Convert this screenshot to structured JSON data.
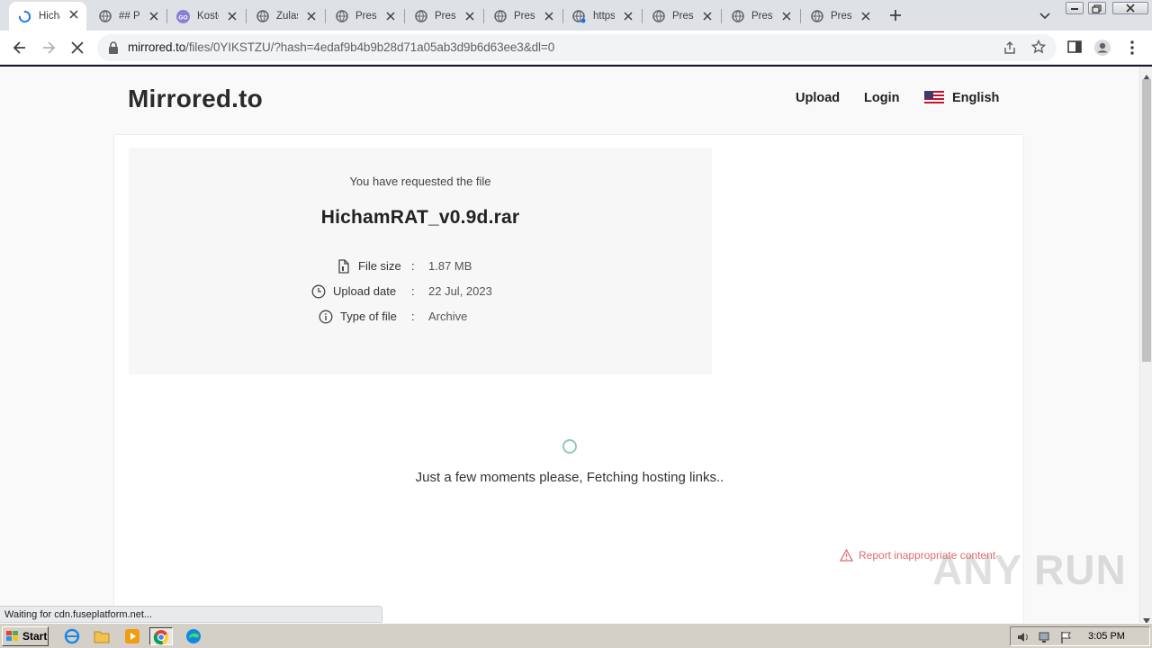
{
  "browser": {
    "tabs": [
      {
        "label": "HichamRAT",
        "icon": "loading-spinner-icon",
        "active": true
      },
      {
        "label": "## Pa",
        "icon": "globe-icon"
      },
      {
        "label": "Kosten",
        "icon": "go-icon"
      },
      {
        "label": "Zulass",
        "icon": "globe-icon"
      },
      {
        "label": "Press",
        "icon": "globe-icon"
      },
      {
        "label": "Press",
        "icon": "globe-icon"
      },
      {
        "label": "Press",
        "icon": "globe-icon"
      },
      {
        "label": "https",
        "icon": "globe-icon"
      },
      {
        "label": "Press",
        "icon": "globe-icon"
      },
      {
        "label": "Press",
        "icon": "globe-icon"
      },
      {
        "label": "Press",
        "icon": "globe-icon"
      }
    ],
    "url_host": "mirrored.to",
    "url_path": "/files/0YIKSTZU/?hash=4edaf9b4b9b28d71a05ab3d9b6d63ee3&dl=0",
    "status_text": "Waiting for cdn.fuseplatform.net..."
  },
  "site": {
    "brand": "Mirrored.to",
    "nav": {
      "upload": "Upload",
      "login": "Login",
      "language": "English"
    }
  },
  "file": {
    "requested_text": "You have requested the file",
    "name": "HichamRAT_v0.9d.rar",
    "meta": [
      {
        "label": "File size",
        "colon": ":",
        "value": "1.87 MB",
        "icon": "file-icon"
      },
      {
        "label": "Upload date",
        "colon": ":",
        "value": "22 Jul, 2023",
        "icon": "clock-icon"
      },
      {
        "label": "Type of file",
        "colon": ":",
        "value": "Archive",
        "icon": "info-icon"
      }
    ]
  },
  "loading_text": "Just a few moments please, Fetching hosting links..",
  "report_text": "Report inappropriate content",
  "watermark": "ANY RUN",
  "taskbar": {
    "start": "Start",
    "clock": "3:05 PM"
  },
  "colors": {
    "accent_spinner": "#8fc9b8",
    "report": "#e06c6c",
    "tabstrip": "#dee1e6",
    "taskbar": "#d4d0c8"
  }
}
